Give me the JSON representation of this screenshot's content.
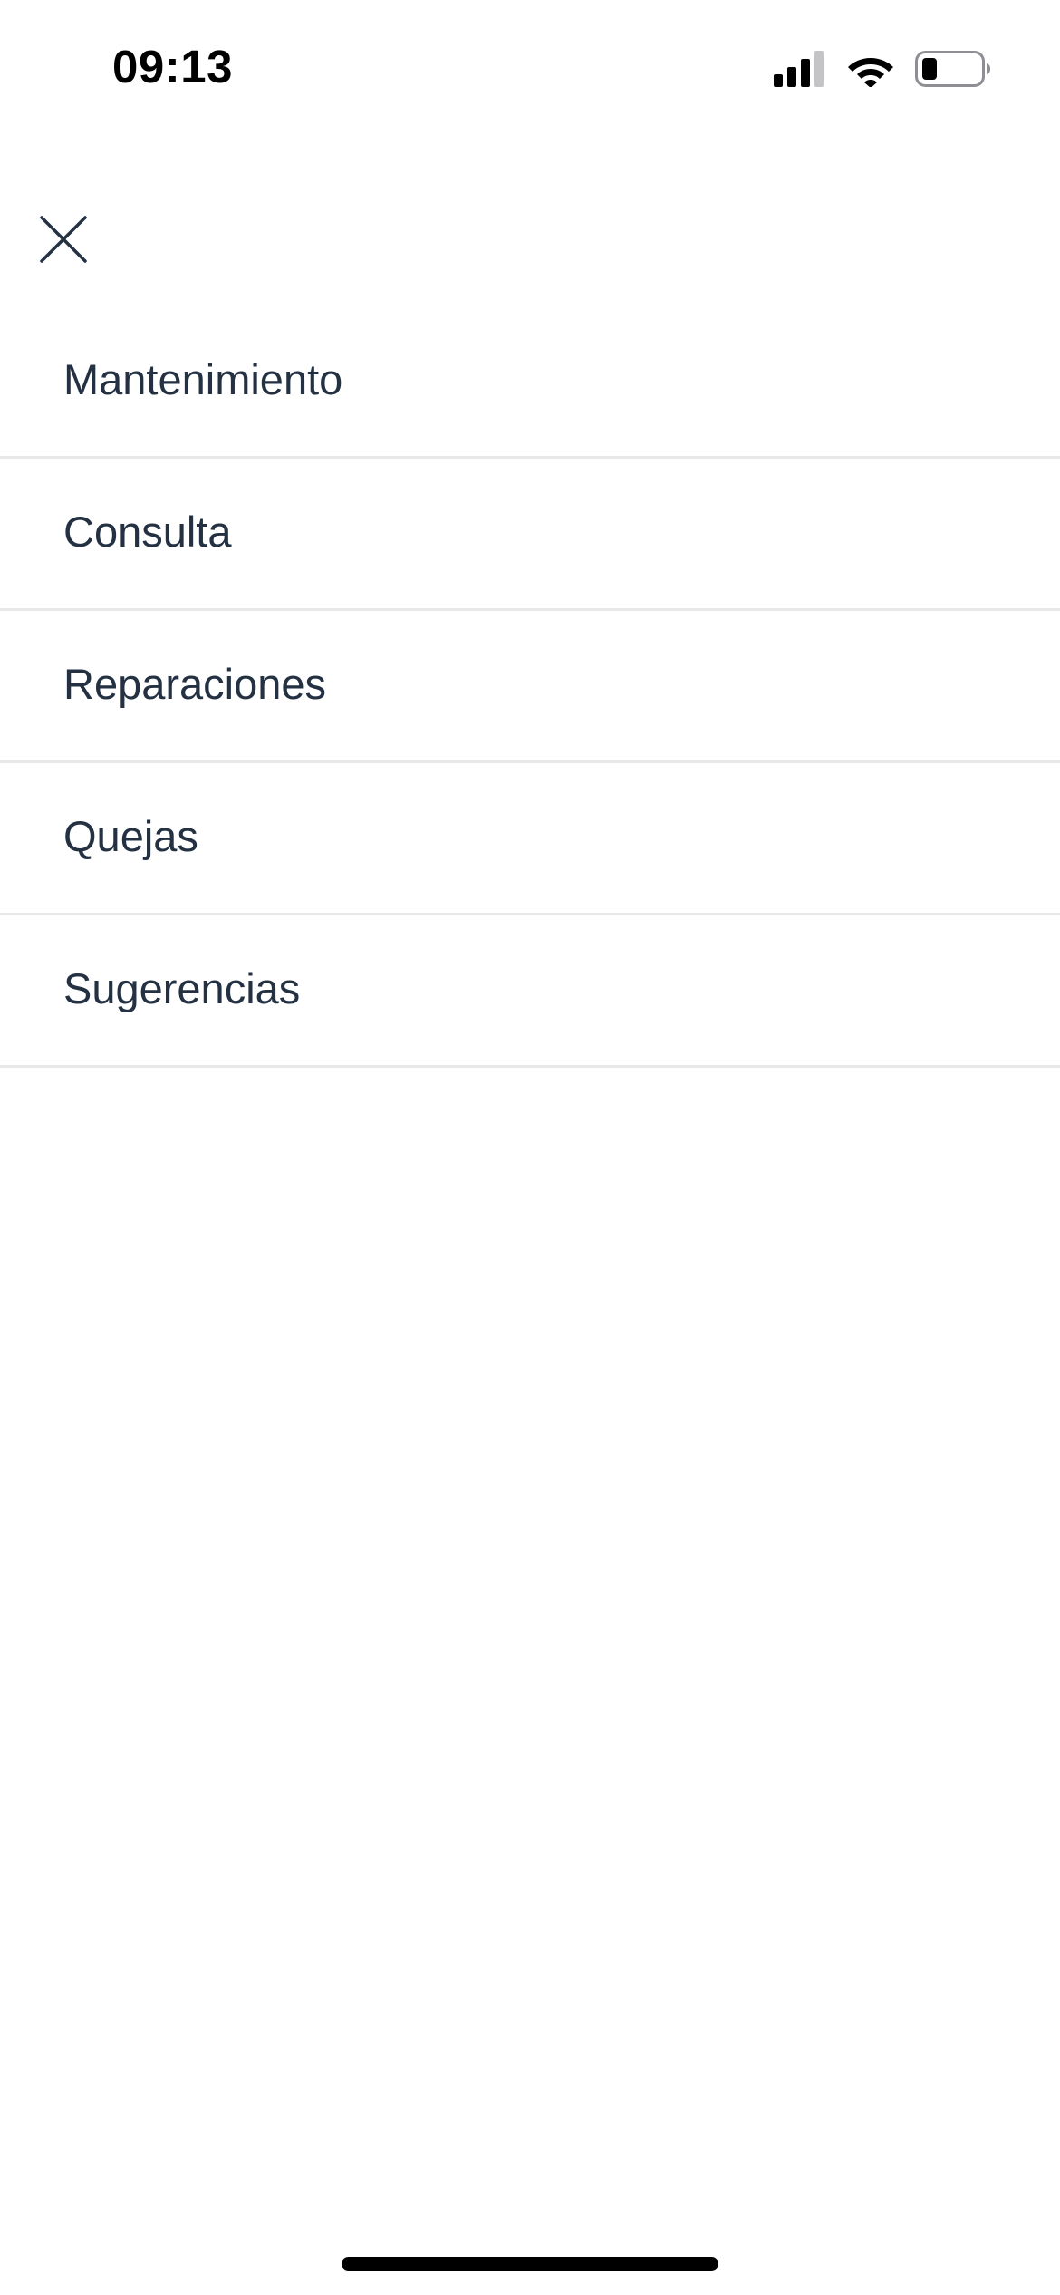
{
  "status_bar": {
    "time": "09:13",
    "icons": [
      "cellular-signal-icon",
      "wifi-icon",
      "battery-icon"
    ]
  },
  "close_icon": "close-icon",
  "menu": {
    "items": [
      {
        "label": "Mantenimiento"
      },
      {
        "label": "Consulta"
      },
      {
        "label": "Reparaciones"
      },
      {
        "label": "Quejas"
      },
      {
        "label": "Sugerencias"
      }
    ]
  },
  "colors": {
    "text": "#243142",
    "divider": "#e6e8ea",
    "background": "#ffffff"
  }
}
